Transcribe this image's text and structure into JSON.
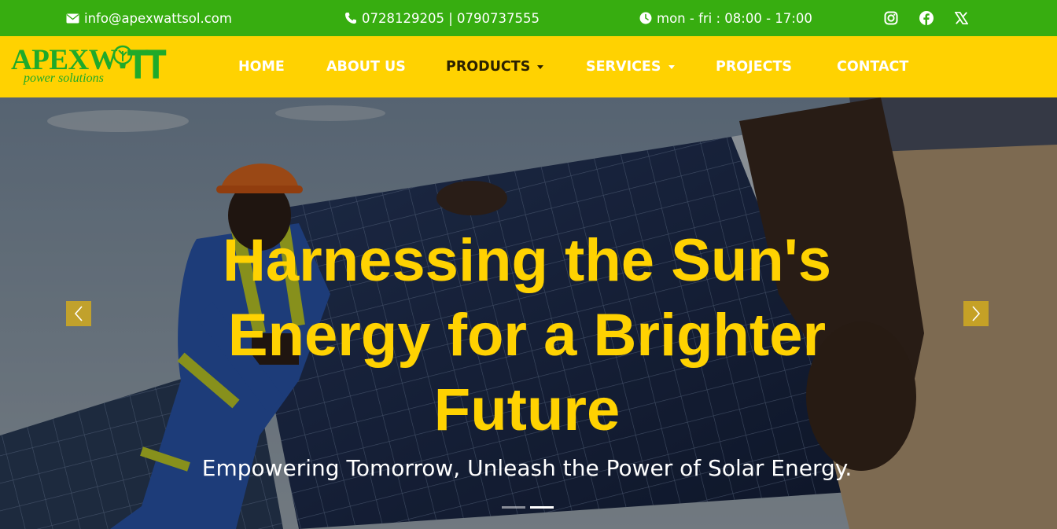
{
  "topbar": {
    "email": "info@apexwattsol.com",
    "phone": "0728129205 | 0790737555",
    "hours": "mon - fri : 08:00 - 17:00",
    "icons": {
      "email": "envelope-icon",
      "phone": "phone-icon",
      "hours": "clock-icon"
    },
    "social": [
      {
        "name": "instagram-icon"
      },
      {
        "name": "facebook-icon"
      },
      {
        "name": "x-twitter-icon"
      }
    ]
  },
  "brand": {
    "logo_main": "APEXW",
    "logo_tt": "TT",
    "logo_sub": "power solutions",
    "logo_icon": "lightbulb-icon"
  },
  "nav": {
    "items": [
      {
        "label": "HOME"
      },
      {
        "label": "ABOUT US"
      },
      {
        "label": "PRODUCTS",
        "dropdown": true,
        "active": true
      },
      {
        "label": "SERVICES",
        "dropdown": true
      },
      {
        "label": "PROJECTS"
      },
      {
        "label": "CONTACT"
      }
    ]
  },
  "hero": {
    "title": "Harnessing the Sun's Energy for a Brighter Future",
    "subtitle": "Empowering Tomorrow, Unleash the Power of Solar Energy.",
    "prev_icon": "chevron-left-icon",
    "next_icon": "chevron-right-icon",
    "indicators_count": 2,
    "active_indicator": 2
  },
  "colors": {
    "topbar": "#37ad10",
    "navbar": "#ffd201",
    "brand_green": "#1faa2a",
    "hero_title": "#ffd201",
    "nav_active": "#2b2100"
  }
}
